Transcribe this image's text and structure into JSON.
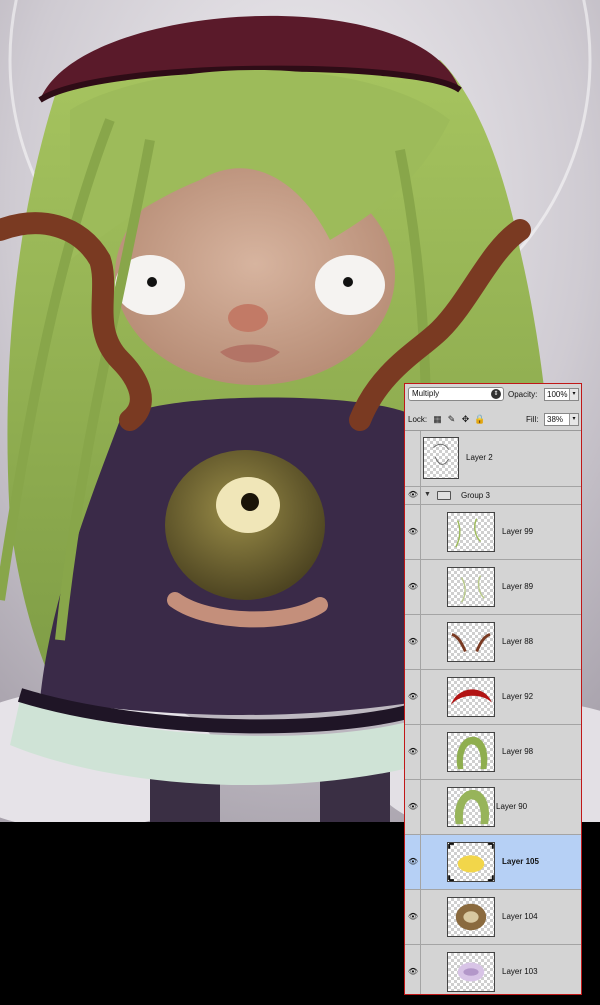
{
  "layers_panel": {
    "blend_mode": "Multiply",
    "opacity_label": "Opacity:",
    "opacity_value": "100%",
    "lock_label": "Lock:",
    "fill_label": "Fill:",
    "fill_value": "38%",
    "group_name": "Group 3",
    "layers": [
      {
        "name": "Layer 2"
      },
      {
        "name": "Layer 99"
      },
      {
        "name": "Layer 89"
      },
      {
        "name": "Layer 88"
      },
      {
        "name": "Layer 92"
      },
      {
        "name": "Layer 98"
      },
      {
        "name": "Layer 90"
      },
      {
        "name": "Layer 105",
        "selected": true
      },
      {
        "name": "Layer 104"
      },
      {
        "name": "Layer 103"
      }
    ]
  },
  "colors": {
    "panel_border": "#c01818",
    "selection": "#b6d0f5",
    "hair": "#9dbb5a",
    "antler": "#7a3a22",
    "hat": "#5a1a2a",
    "dress": "#3a2a48"
  },
  "icons": [
    "eye-icon",
    "chevron-down-icon",
    "folder-icon",
    "lock-icon",
    "move-icon",
    "brush-icon",
    "transparency-lock-icon"
  ]
}
